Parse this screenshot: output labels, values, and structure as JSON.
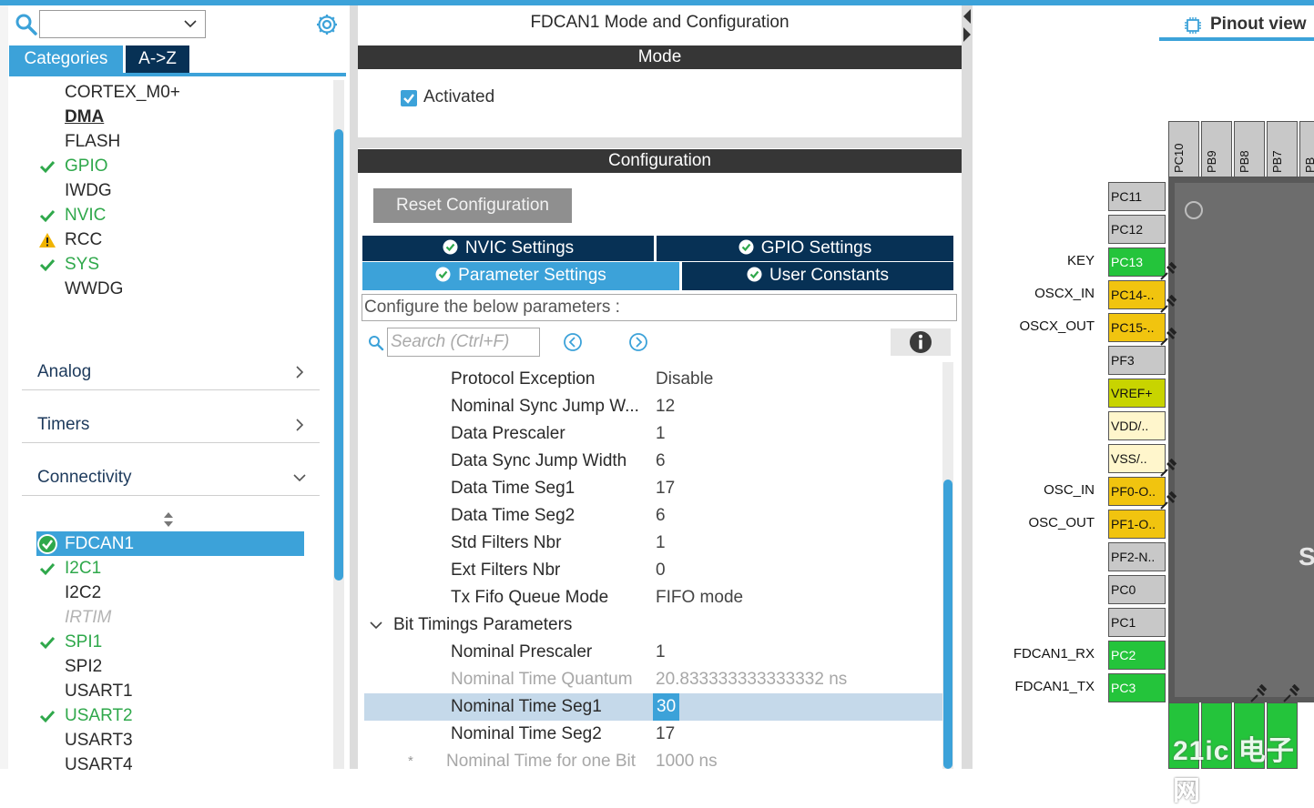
{
  "left": {
    "tab_categories": "Categories",
    "tab_az": "A->Z",
    "system_items": [
      {
        "label": "CORTEX_M0+",
        "state": "none"
      },
      {
        "label": "DMA",
        "state": "bold"
      },
      {
        "label": "FLASH",
        "state": "none"
      },
      {
        "label": "GPIO",
        "state": "check"
      },
      {
        "label": "IWDG",
        "state": "none"
      },
      {
        "label": "NVIC",
        "state": "check"
      },
      {
        "label": "RCC",
        "state": "warning"
      },
      {
        "label": "SYS",
        "state": "check"
      },
      {
        "label": "WWDG",
        "state": "none"
      }
    ],
    "categories": [
      {
        "label": "Analog",
        "expanded": false
      },
      {
        "label": "Timers",
        "expanded": false
      },
      {
        "label": "Connectivity",
        "expanded": true
      }
    ],
    "connectivity_items": [
      {
        "label": "FDCAN1",
        "state": "selected"
      },
      {
        "label": "I2C1",
        "state": "check"
      },
      {
        "label": "I2C2",
        "state": "none"
      },
      {
        "label": "IRTIM",
        "state": "disabled"
      },
      {
        "label": "SPI1",
        "state": "check"
      },
      {
        "label": "SPI2",
        "state": "none"
      },
      {
        "label": "USART1",
        "state": "none"
      },
      {
        "label": "USART2",
        "state": "check"
      },
      {
        "label": "USART3",
        "state": "none"
      },
      {
        "label": "USART4",
        "state": "none"
      }
    ]
  },
  "middle": {
    "title": "FDCAN1 Mode and Configuration",
    "mode_band": "Mode",
    "activated_label": "Activated",
    "activated_checked": true,
    "config_band": "Configuration",
    "reset_button": "Reset Configuration",
    "tabs": [
      {
        "label": "NVIC Settings",
        "active": false
      },
      {
        "label": "GPIO Settings",
        "active": false
      },
      {
        "label": "Parameter Settings",
        "active": true
      },
      {
        "label": "User Constants",
        "active": false
      }
    ],
    "configure_text": "Configure the below parameters :",
    "search_placeholder": "Search (Ctrl+F)",
    "params": [
      {
        "name": "Protocol Exception",
        "value": "Disable",
        "kind": "normal"
      },
      {
        "name": "Nominal Sync Jump W...",
        "value": "12",
        "kind": "normal"
      },
      {
        "name": "Data Prescaler",
        "value": "1",
        "kind": "normal"
      },
      {
        "name": "Data Sync Jump Width",
        "value": "6",
        "kind": "normal"
      },
      {
        "name": "Data Time Seg1",
        "value": "17",
        "kind": "normal"
      },
      {
        "name": "Data Time Seg2",
        "value": "6",
        "kind": "normal"
      },
      {
        "name": "Std Filters Nbr",
        "value": "1",
        "kind": "normal"
      },
      {
        "name": "Ext Filters Nbr",
        "value": "0",
        "kind": "normal"
      },
      {
        "name": "Tx Fifo Queue Mode",
        "value": "FIFO mode",
        "kind": "normal"
      },
      {
        "name": "Bit Timings Parameters",
        "value": "",
        "kind": "group"
      },
      {
        "name": "Nominal Prescaler",
        "value": "1",
        "kind": "normal"
      },
      {
        "name": "Nominal Time Quantum",
        "value": "20.833333333333332 ns",
        "kind": "greyed"
      },
      {
        "name": "Nominal Time Seg1",
        "value": "30",
        "kind": "selected"
      },
      {
        "name": "Nominal Time Seg2",
        "value": "17",
        "kind": "normal"
      },
      {
        "name": "Nominal Time for one Bit",
        "value": "1000 ns",
        "kind": "greyed-star",
        "star": "*"
      }
    ]
  },
  "right": {
    "title": "Pinout view",
    "top_pins": [
      "PC10",
      "PB9",
      "PB8",
      "PB7",
      "PB"
    ],
    "left_pins": [
      {
        "pin": "PC11",
        "signal": "",
        "color": "#c8c8c8"
      },
      {
        "pin": "PC12",
        "signal": "",
        "color": "#c8c8c8"
      },
      {
        "pin": "PC13",
        "signal": "KEY",
        "color": "#24c43b"
      },
      {
        "pin": "PC14-..",
        "signal": "OSCX_IN",
        "color": "#f1c40f"
      },
      {
        "pin": "PC15-..",
        "signal": "OSCX_OUT",
        "color": "#f1c40f"
      },
      {
        "pin": "PF3",
        "signal": "",
        "color": "#c8c8c8"
      },
      {
        "pin": "VREF+",
        "signal": "",
        "color": "#c8d400"
      },
      {
        "pin": "VDD/..",
        "signal": "",
        "color": "#fff6cc"
      },
      {
        "pin": "VSS/..",
        "signal": "",
        "color": "#fff6cc"
      },
      {
        "pin": "PF0-O..",
        "signal": "OSC_IN",
        "color": "#f1c40f"
      },
      {
        "pin": "PF1-O..",
        "signal": "OSC_OUT",
        "color": "#f1c40f"
      },
      {
        "pin": "PF2-N..",
        "signal": "",
        "color": "#c8c8c8"
      },
      {
        "pin": "PC0",
        "signal": "",
        "color": "#c8c8c8"
      },
      {
        "pin": "PC1",
        "signal": "",
        "color": "#c8c8c8"
      },
      {
        "pin": "PC2",
        "signal": "FDCAN1_RX",
        "color": "#24c43b"
      },
      {
        "pin": "PC3",
        "signal": "FDCAN1_TX",
        "color": "#24c43b"
      }
    ],
    "chip_letter": "S",
    "watermark": "21ic 电子网"
  },
  "colors": {
    "accent": "#3ca2d9",
    "navy": "#073155",
    "band": "#363636",
    "ok_green": "#2fa84b",
    "warning": "#f0b400"
  }
}
